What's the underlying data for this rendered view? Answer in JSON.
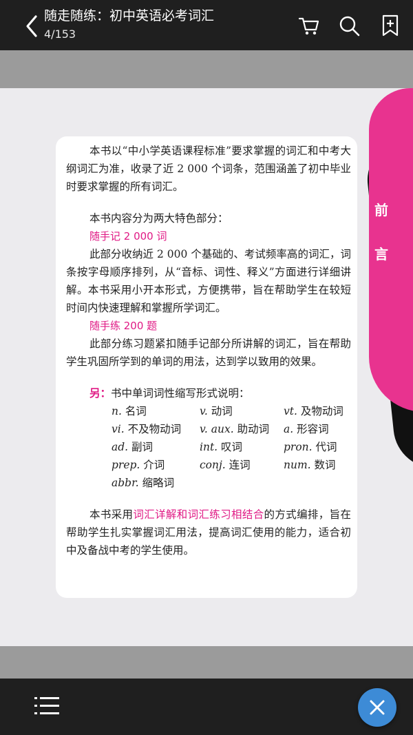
{
  "header": {
    "title": "随走随练：初中英语必考词汇",
    "page_indicator": "4/153",
    "icons": [
      "back-icon",
      "cart-icon",
      "search-icon",
      "bookmark-add-icon"
    ]
  },
  "page": {
    "side_tab": [
      "前",
      "言"
    ],
    "intro": "本书以“中小学英语课程标准”要求掌握的词汇和中考大纲词汇为准，收录了近 2 000 个词条，范围涵盖了初中毕业时要求掌握的所有词汇。",
    "features_intro": "本书内容分为两大特色部分：",
    "section1_title": "随手记 2 000 词",
    "section1_body": "此部分收纳近 2 000 个基础的、考试频率高的词汇，词条按字母顺序排列，从“音标、词性、释义”方面进行详细讲解。本书采用小开本形式，方便携带，旨在帮助学生在较短时间内快速理解和掌握所学词汇。",
    "section2_title": "随手练 200 题",
    "section2_body": "此部分练习题紧扣随手记部分所讲解的词汇，旨在帮助学生巩固所学到的单词的用法，达到学以致用的效果。",
    "note_label": "另：",
    "note_text": "书中单词词性缩写形式说明：",
    "abbreviations": [
      {
        "abbr": "n.",
        "meaning": "名词"
      },
      {
        "abbr": "v.",
        "meaning": "动词"
      },
      {
        "abbr": "vt.",
        "meaning": "及物动词"
      },
      {
        "abbr": "vi.",
        "meaning": "不及物动词"
      },
      {
        "abbr": "v. aux.",
        "meaning": "助动词"
      },
      {
        "abbr": "a.",
        "meaning": "形容词"
      },
      {
        "abbr": "ad.",
        "meaning": "副词"
      },
      {
        "abbr": "int.",
        "meaning": "叹词"
      },
      {
        "abbr": "pron.",
        "meaning": "代词"
      },
      {
        "abbr": "prep.",
        "meaning": "介词"
      },
      {
        "abbr": "conj.",
        "meaning": "连词"
      },
      {
        "abbr": "num.",
        "meaning": "数词"
      },
      {
        "abbr": "abbr.",
        "meaning": "缩略词"
      }
    ],
    "closing_pre": "本书采用",
    "closing_highlight": "词汇详解和词汇练习相结合",
    "closing_post": "的方式编排，旨在帮助学生扎实掌握词汇用法，提高词汇使用的能力，适合初中及备战中考的学生使用。"
  },
  "footer": {
    "icons": [
      "menu-list-icon",
      "close-icon"
    ]
  },
  "colors": {
    "bar": "#1f1f1f",
    "accent_pink": "#e8338f",
    "fab_blue": "#3d8bd6"
  }
}
